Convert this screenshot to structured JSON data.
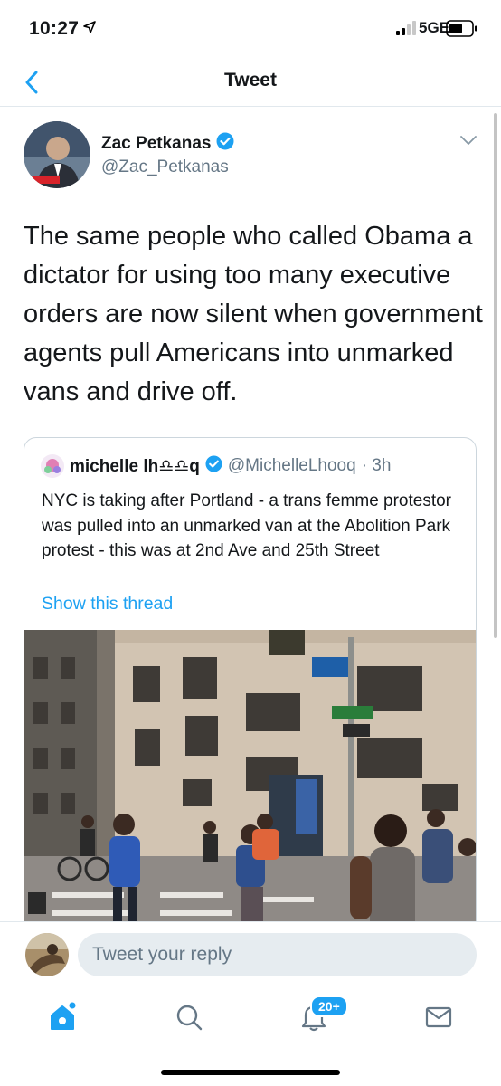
{
  "status_bar": {
    "time": "10:27",
    "network": "5GE",
    "icons": [
      "location-arrow-icon",
      "signal-icon",
      "battery-icon"
    ]
  },
  "header": {
    "back_icon": "chevron-left-icon",
    "title": "Tweet"
  },
  "tweet": {
    "author_name": "Zac Petkanas",
    "verified": true,
    "author_handle": "@Zac_Petkanas",
    "text": "The same people who called Obama a dictator for using too many executive orders are now silent when government agents pull Americans into unmarked vans and drive off."
  },
  "quoted_tweet": {
    "author_name": "michelle lh♎♎q",
    "verified": true,
    "author_handle": "@MichelleLhooq",
    "time": "· 3h",
    "text": "NYC is taking after Portland - a trans femme protestor was pulled into an unmarked van at the Abolition Park protest - this was at 2nd Ave and 25th Street",
    "show_thread": "Show this thread"
  },
  "reply": {
    "placeholder": "Tweet your reply"
  },
  "tab_bar": {
    "items": [
      "home-icon",
      "search-icon",
      "notifications-icon",
      "messages-icon"
    ],
    "notifications_badge": "20+"
  },
  "colors": {
    "accent": "#1da1f2",
    "secondary_text": "#657786",
    "border": "#ccd6dd"
  }
}
